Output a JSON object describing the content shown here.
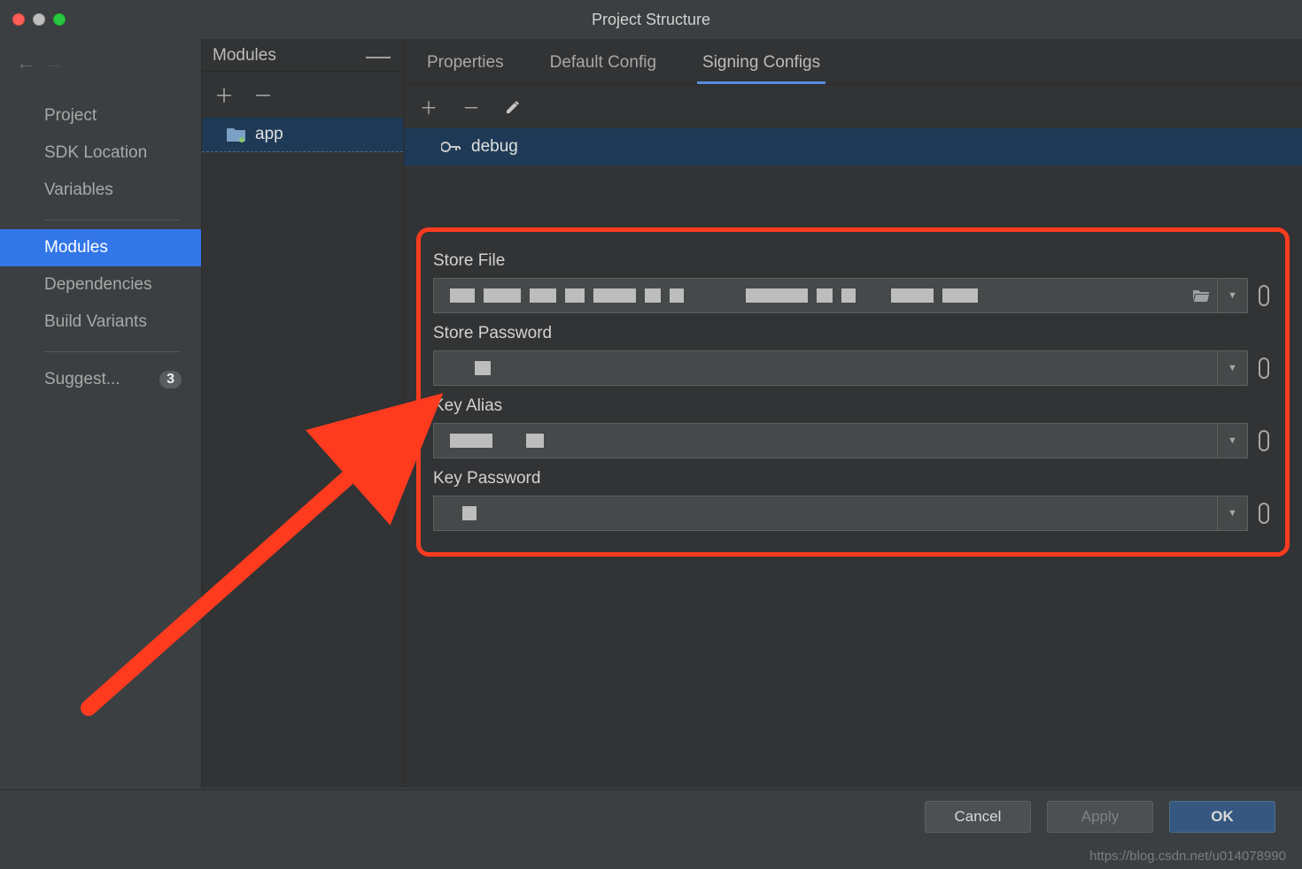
{
  "window": {
    "title": "Project Structure"
  },
  "sidebar": {
    "items": [
      {
        "label": "Project"
      },
      {
        "label": "SDK Location"
      },
      {
        "label": "Variables"
      },
      {
        "label": "Modules"
      },
      {
        "label": "Dependencies"
      },
      {
        "label": "Build Variants"
      },
      {
        "label": "Suggest...",
        "badge": "3"
      }
    ],
    "selected": "Modules"
  },
  "modules": {
    "panel_title": "Modules",
    "items": [
      {
        "label": "app"
      }
    ]
  },
  "tabs": {
    "items": [
      {
        "label": "Properties"
      },
      {
        "label": "Default Config"
      },
      {
        "label": "Signing Configs"
      }
    ],
    "active": "Signing Configs"
  },
  "configs": {
    "items": [
      {
        "label": "debug"
      }
    ]
  },
  "form": {
    "store_file_label": "Store File",
    "store_password_label": "Store Password",
    "key_alias_label": "Key Alias",
    "key_password_label": "Key Password"
  },
  "buttons": {
    "cancel": "Cancel",
    "apply": "Apply",
    "ok": "OK"
  },
  "watermark": "https://blog.csdn.net/u014078990"
}
